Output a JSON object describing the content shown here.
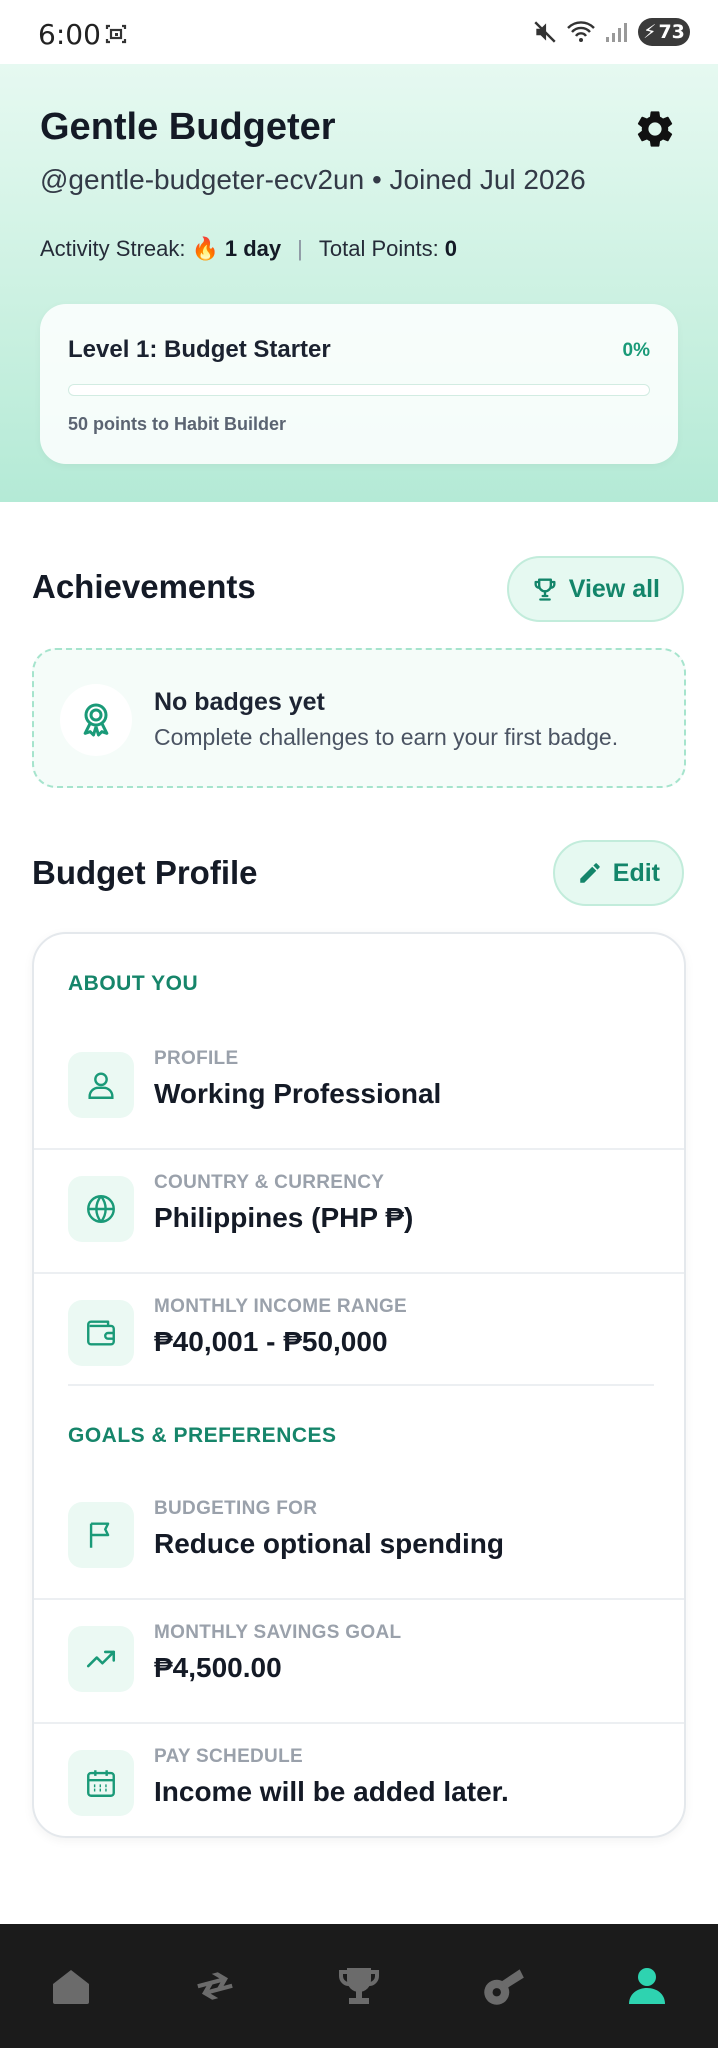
{
  "status_bar": {
    "time": "6:00",
    "battery": "73"
  },
  "header": {
    "name": "Gentle Budgeter",
    "subtitle": "@gentle-budgeter-ecv2un • Joined Jul 2026",
    "streak_label": "Activity Streak:",
    "streak_emoji": "🔥",
    "streak_value": "1 day",
    "separator": "|",
    "points_label": "Total Points:",
    "points_value": "0"
  },
  "level": {
    "title": "Level 1: Budget Starter",
    "percent_label": "0%",
    "progress": 0,
    "note": "50 points to Habit Builder"
  },
  "achievements": {
    "title": "Achievements",
    "view_all_label": "View all",
    "empty_title": "No badges yet",
    "empty_desc": "Complete challenges to earn your first badge."
  },
  "budget_profile": {
    "title": "Budget Profile",
    "edit_label": "Edit",
    "about_label": "ABOUT YOU",
    "goals_label": "GOALS & PREFERENCES",
    "about_rows": [
      {
        "label": "PROFILE",
        "value": "Working Professional",
        "icon": "user-icon"
      },
      {
        "label": "COUNTRY & CURRENCY",
        "value": "Philippines (PHP ₱)",
        "icon": "globe-icon"
      },
      {
        "label": "MONTHLY INCOME RANGE",
        "value": "₱40,001 - ₱50,000",
        "icon": "wallet-icon"
      }
    ],
    "goal_rows": [
      {
        "label": "BUDGETING FOR",
        "value": "Reduce optional spending",
        "icon": "flag-icon"
      },
      {
        "label": "MONTHLY SAVINGS GOAL",
        "value": "₱4,500.00",
        "icon": "trending-up-icon"
      },
      {
        "label": "PAY SCHEDULE",
        "value": "Income will be added later.",
        "icon": "calendar-icon"
      }
    ]
  },
  "bottom_nav": [
    {
      "icon": "home-icon",
      "active": false
    },
    {
      "icon": "transfer-icon",
      "active": false
    },
    {
      "icon": "trophy-icon",
      "active": false
    },
    {
      "icon": "whistle-icon",
      "active": false
    },
    {
      "icon": "profile-icon",
      "active": true
    }
  ],
  "colors": {
    "accent": "#1a9a78",
    "accent_light": "#e6f9f1",
    "nav_active": "#2ed3b0",
    "nav_inactive": "#6b6b6b"
  }
}
